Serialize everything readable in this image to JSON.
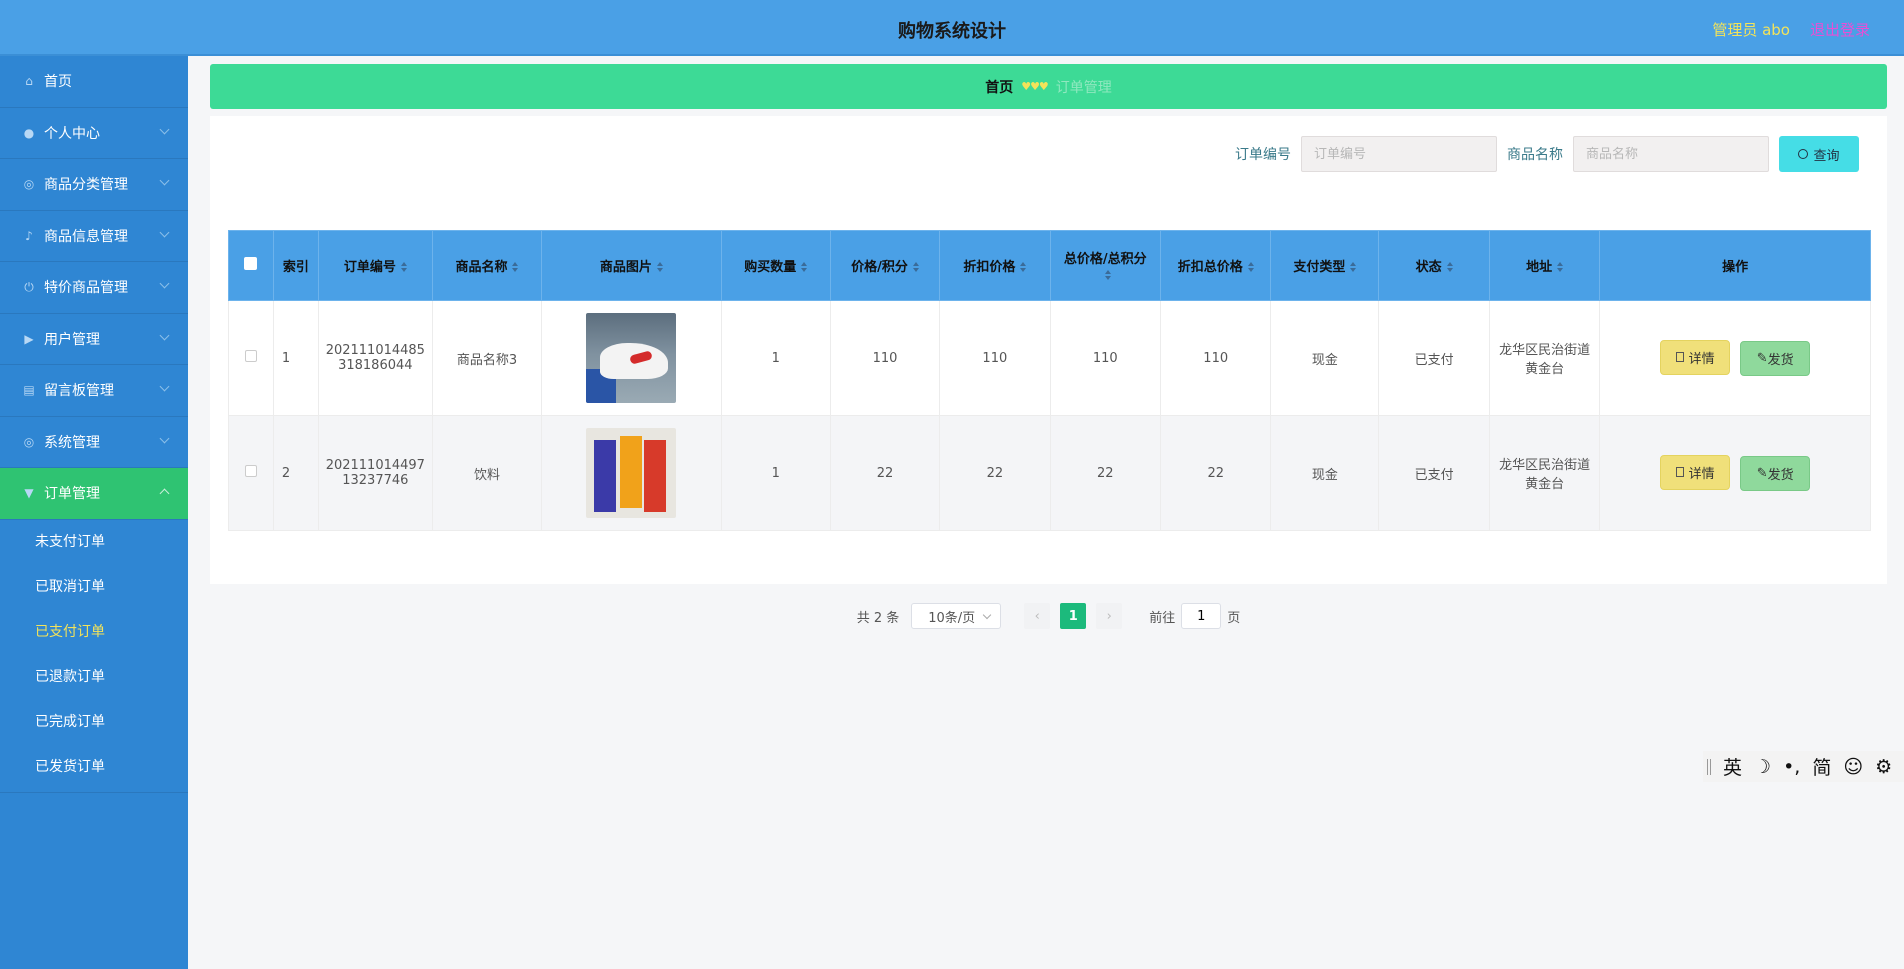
{
  "header": {
    "title": "购物系统设计",
    "user": "管理员 abo",
    "logout": "退出登录"
  },
  "sidebar": {
    "items": [
      {
        "label": "首页",
        "icon": "home-icon"
      },
      {
        "label": "个人中心",
        "icon": "user-icon"
      },
      {
        "label": "商品分类管理",
        "icon": "compass-icon"
      },
      {
        "label": "商品信息管理",
        "icon": "bell-icon"
      },
      {
        "label": "特价商品管理",
        "icon": "power-icon"
      },
      {
        "label": "用户管理",
        "icon": "video-icon"
      },
      {
        "label": "留言板管理",
        "icon": "clipboard-icon"
      },
      {
        "label": "系统管理",
        "icon": "compass-icon"
      },
      {
        "label": "订单管理",
        "icon": "bucket-icon"
      }
    ],
    "submenu": [
      "未支付订单",
      "已取消订单",
      "已支付订单",
      "已退款订单",
      "已完成订单",
      "已发货订单"
    ]
  },
  "breadcrumb": {
    "home": "首页",
    "sep": "♥♥♥",
    "current": "订单管理"
  },
  "search": {
    "order_label": "订单编号",
    "order_placeholder": "订单编号",
    "product_label": "商品名称",
    "product_placeholder": "商品名称",
    "button": "查询"
  },
  "table": {
    "headers": [
      "索引",
      "订单编号",
      "商品名称",
      "商品图片",
      "购买数量",
      "价格/积分",
      "折扣价格",
      "总价格/总积分",
      "折扣总价格",
      "支付类型",
      "状态",
      "地址",
      "操作"
    ],
    "rows": [
      {
        "index": "1",
        "order_no_1": "202111014485",
        "order_no_2": "318186044",
        "name": "商品名称3",
        "qty": "1",
        "price": "110",
        "discount": "110",
        "total": "110",
        "discount_total": "110",
        "pay": "现金",
        "status": "已支付",
        "addr_1": "龙华区民治街道",
        "addr_2": "黄金台"
      },
      {
        "index": "2",
        "order_no_1": "202111014497",
        "order_no_2": "13237746",
        "name": "饮料",
        "qty": "1",
        "price": "22",
        "discount": "22",
        "total": "22",
        "discount_total": "22",
        "pay": "现金",
        "status": "已支付",
        "addr_1": "龙华区民治街道",
        "addr_2": "黄金台"
      }
    ],
    "detail_btn": "详情",
    "ship_btn": "发货"
  },
  "pager": {
    "total": "共 2 条",
    "size": "10条/页",
    "page": "1",
    "goto": "前往",
    "goto_value": "1",
    "page_suffix": "页"
  },
  "ime": {
    "items": [
      "英",
      "☽",
      "•,",
      "简",
      "☺",
      "⚙"
    ]
  }
}
